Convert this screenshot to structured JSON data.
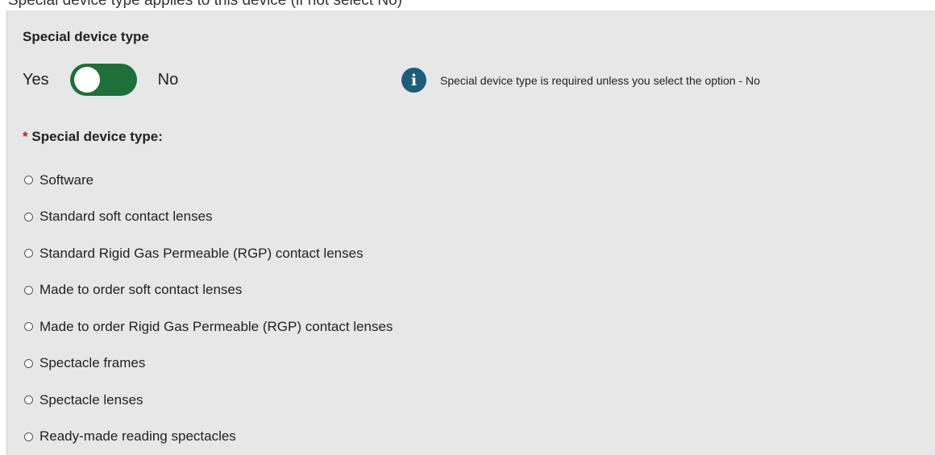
{
  "top_strip": {
    "text": "Special device type applies to this device (if not select No)"
  },
  "section": {
    "title": "Special device type"
  },
  "toggle": {
    "left_label": "Yes",
    "right_label": "No",
    "state": "on",
    "color": "#1f6f3b"
  },
  "info": {
    "icon": "info-icon",
    "icon_glyph": "i",
    "text": "Special device type is required unless you select the option - No"
  },
  "field": {
    "required_marker": "*",
    "label": "Special device type:",
    "options": [
      {
        "label": "Software",
        "selected": false
      },
      {
        "label": "Standard soft contact lenses",
        "selected": false
      },
      {
        "label": "Standard Rigid Gas Permeable (RGP) contact lenses",
        "selected": false
      },
      {
        "label": "Made to order soft contact lenses",
        "selected": false
      },
      {
        "label": "Made to order Rigid Gas Permeable (RGP) contact lenses",
        "selected": false
      },
      {
        "label": "Spectacle frames",
        "selected": false
      },
      {
        "label": "Spectacle lenses",
        "selected": false
      },
      {
        "label": "Ready-made reading spectacles",
        "selected": false
      }
    ]
  }
}
